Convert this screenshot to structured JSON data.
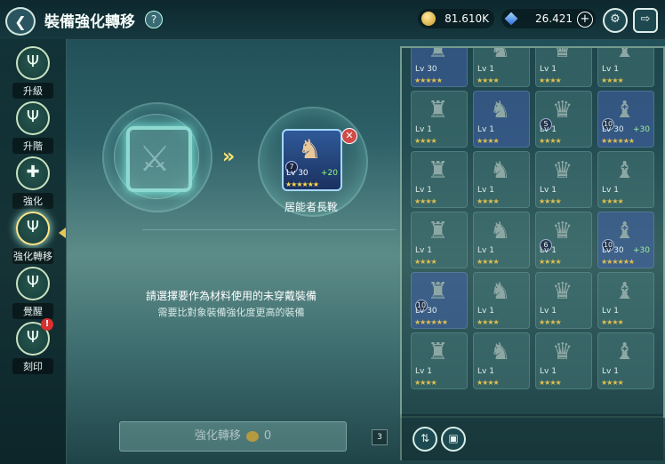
{
  "header": {
    "title": "裝備強化轉移",
    "help_label": "?",
    "gold": "81.610K",
    "gems": "26.421",
    "plus_label": "+"
  },
  "sidebar": {
    "items": [
      {
        "label": "升級",
        "icon": "trident-emblem-icon"
      },
      {
        "label": "升階",
        "icon": "trident-emblem-icon"
      },
      {
        "label": "強化",
        "icon": "trident-plus-icon"
      },
      {
        "label": "強化轉移",
        "icon": "trident-transfer-icon",
        "active": true
      },
      {
        "label": "覺醒",
        "icon": "trident-emblem-icon"
      },
      {
        "label": "刻印",
        "icon": "trident-emblem-icon",
        "badge": "!"
      }
    ]
  },
  "target": {
    "name": "居能者長靴",
    "level": "Lv 30",
    "plus": "+20",
    "tier": "7",
    "stars": "★★★★★★"
  },
  "hints": {
    "primary": "請選擇要作為材料使用的未穿戴裝備",
    "secondary": "需要比對象裝備強化度更高的裝備"
  },
  "transfer_button": {
    "label": "強化轉移",
    "cost": "0"
  },
  "counter_label": "3",
  "inventory": [
    {
      "lvl": "Lv 30",
      "plus": "",
      "tier": "",
      "stars": "★★★★★",
      "blue": true
    },
    {
      "lvl": "Lv 1",
      "plus": "",
      "tier": "",
      "stars": "★★★★"
    },
    {
      "lvl": "Lv 1",
      "plus": "",
      "tier": "",
      "stars": "★★★★"
    },
    {
      "lvl": "Lv 1",
      "plus": "",
      "tier": "",
      "stars": "★★★★"
    },
    {
      "lvl": "Lv 1",
      "plus": "",
      "tier": "",
      "stars": "★★★★"
    },
    {
      "lvl": "Lv 1",
      "plus": "",
      "tier": "",
      "stars": "★★★★",
      "blue": true
    },
    {
      "lvl": "Lv 1",
      "plus": "",
      "tier": "5",
      "stars": "★★★★"
    },
    {
      "lvl": "Lv 30",
      "plus": "+30",
      "tier": "10",
      "stars": "★★★★★★",
      "blue": true
    },
    {
      "lvl": "Lv 1",
      "plus": "",
      "tier": "",
      "stars": "★★★★"
    },
    {
      "lvl": "Lv 1",
      "plus": "",
      "tier": "",
      "stars": "★★★★"
    },
    {
      "lvl": "Lv 1",
      "plus": "",
      "tier": "",
      "stars": "★★★★"
    },
    {
      "lvl": "Lv 1",
      "plus": "",
      "tier": "",
      "stars": "★★★★"
    },
    {
      "lvl": "Lv 1",
      "plus": "",
      "tier": "",
      "stars": "★★★★"
    },
    {
      "lvl": "Lv 1",
      "plus": "",
      "tier": "",
      "stars": "★★★★"
    },
    {
      "lvl": "Lv 1",
      "plus": "",
      "tier": "6",
      "stars": "★★★★"
    },
    {
      "lvl": "Lv 30",
      "plus": "+30",
      "tier": "10",
      "stars": "★★★★★★",
      "blue": true
    },
    {
      "lvl": "Lv 30",
      "plus": "",
      "tier": "10",
      "stars": "★★★★★★",
      "blue": true
    },
    {
      "lvl": "Lv 1",
      "plus": "",
      "tier": "",
      "stars": "★★★★"
    },
    {
      "lvl": "Lv 1",
      "plus": "",
      "tier": "",
      "stars": "★★★★"
    },
    {
      "lvl": "Lv 1",
      "plus": "",
      "tier": "",
      "stars": "★★★★"
    },
    {
      "lvl": "Lv 1",
      "plus": "",
      "tier": "",
      "stars": "★★★★"
    },
    {
      "lvl": "Lv 1",
      "plus": "",
      "tier": "",
      "stars": "★★★★"
    },
    {
      "lvl": "Lv 1",
      "plus": "",
      "tier": "",
      "stars": "★★★★"
    },
    {
      "lvl": "Lv 1",
      "plus": "",
      "tier": "",
      "stars": "★★★★"
    }
  ]
}
